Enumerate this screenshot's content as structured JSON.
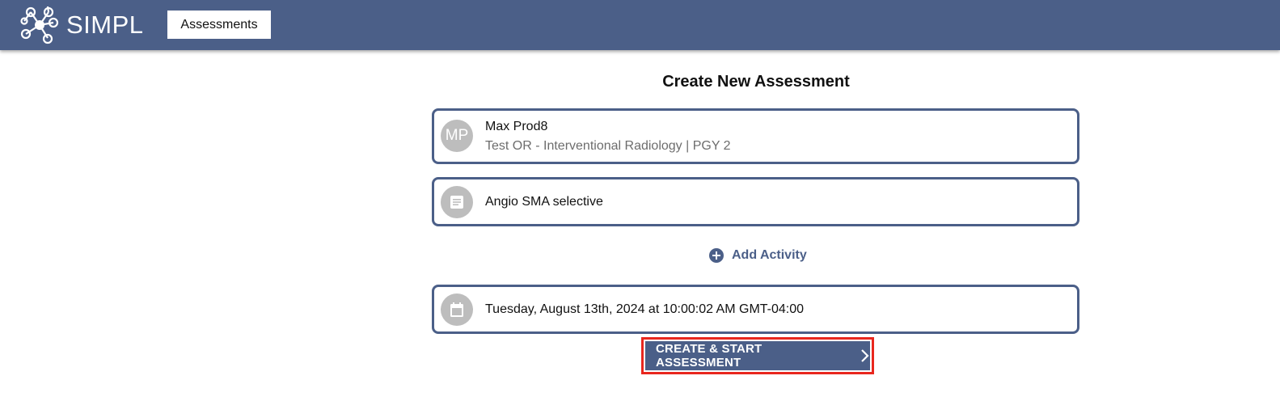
{
  "header": {
    "brand": "SIMPL",
    "logo_icon": "molecule-network-icon",
    "nav_tab_label": "Assessments",
    "background_color": "#4b5f88"
  },
  "page": {
    "title": "Create New Assessment"
  },
  "trainee": {
    "initials": "MP",
    "name": "Max Prod8",
    "details": "Test OR - Interventional Radiology | PGY 2"
  },
  "activity": {
    "icon": "document-icon",
    "name": "Angio SMA selective"
  },
  "add_activity": {
    "icon": "plus-circle-icon",
    "label": "Add Activity"
  },
  "date": {
    "icon": "calendar-icon",
    "value": "Tuesday, August 13th, 2024 at 10:00:02 AM GMT-04:00"
  },
  "actions": {
    "create_start_label": "CREATE & START ASSESSMENT",
    "chevron_icon": "chevron-right-icon",
    "highlight_color": "#e8271e"
  }
}
